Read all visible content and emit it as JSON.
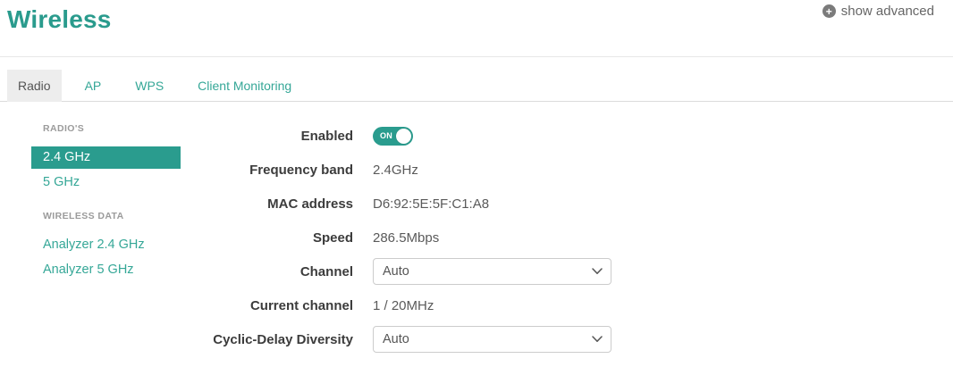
{
  "page": {
    "title": "Wireless",
    "show_advanced_label": "show advanced",
    "show_advanced_icon": "+"
  },
  "tabs": [
    {
      "label": "Radio",
      "active": true
    },
    {
      "label": "AP",
      "active": false
    },
    {
      "label": "WPS",
      "active": false
    },
    {
      "label": "Client Monitoring",
      "active": false
    }
  ],
  "sidebar": {
    "sections": [
      {
        "header": "RADIO'S",
        "items": [
          {
            "label": "2.4 GHz",
            "selected": true
          },
          {
            "label": "5 GHz",
            "selected": false
          }
        ]
      },
      {
        "header": "WIRELESS DATA",
        "items": [
          {
            "label": "Analyzer 2.4 GHz",
            "selected": false
          },
          {
            "label": "Analyzer 5 GHz",
            "selected": false
          }
        ]
      }
    ]
  },
  "form": {
    "rows": [
      {
        "label": "Enabled",
        "type": "toggle",
        "value": "ON",
        "state": true
      },
      {
        "label": "Frequency band",
        "type": "text",
        "value": "2.4GHz"
      },
      {
        "label": "MAC address",
        "type": "text",
        "value": "D6:92:5E:5F:C1:A8"
      },
      {
        "label": "Speed",
        "type": "text",
        "value": "286.5Mbps"
      },
      {
        "label": "Channel",
        "type": "select",
        "value": "Auto"
      },
      {
        "label": "Current channel",
        "type": "text",
        "value": "1 / 20MHz"
      },
      {
        "label": "Cyclic-Delay Diversity",
        "type": "select",
        "value": "Auto"
      }
    ]
  },
  "colors": {
    "primary_teal": "#2a9c8e",
    "title_teal": "#2a9b8d",
    "link_teal": "#35a797",
    "active_tab_bg": "#ededed",
    "label_text": "#3c3c3c",
    "value_text": "#5a5a5a",
    "section_header_text": "#9b9b9b"
  }
}
